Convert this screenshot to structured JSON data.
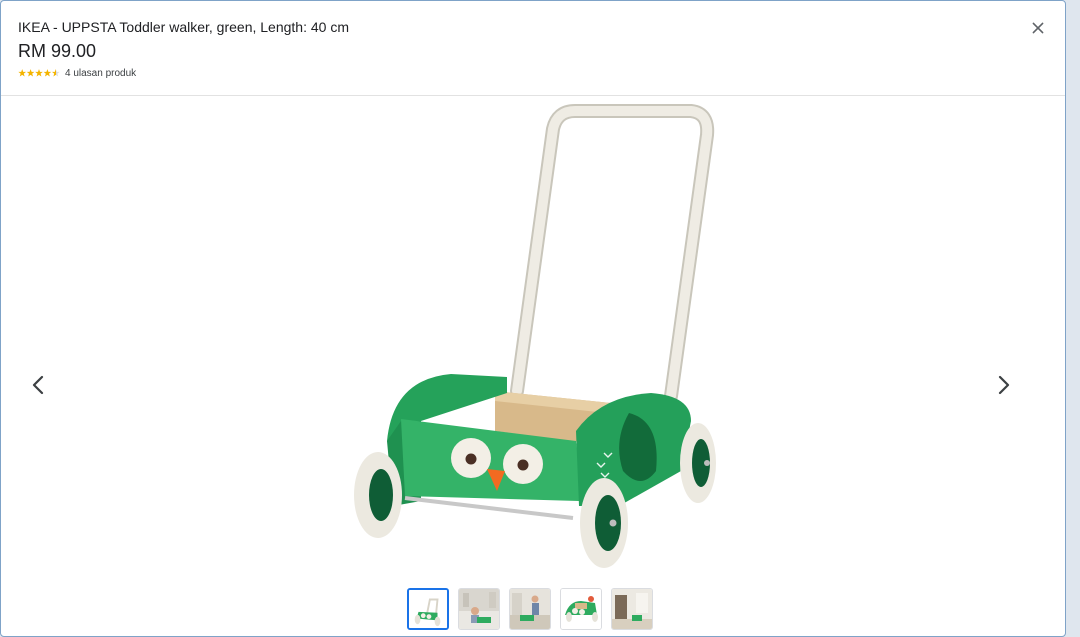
{
  "product": {
    "title": "IKEA - UPPSTA Toddler walker, green, Length: 40 cm",
    "price": "RM 99.00",
    "rating_value": 4.5,
    "rating_max": 5,
    "reviews_text": "4 ulasan produk"
  },
  "icons": {
    "close": "close-icon",
    "prev": "chevron-left-icon",
    "next": "chevron-right-icon",
    "stars": "star-rating-icon"
  },
  "colors": {
    "star": "#f4b400",
    "walker_green": "#2eab5f",
    "active_thumb_border": "#1a73e8"
  },
  "thumbnails": [
    {
      "name": "walker product shot",
      "active": true
    },
    {
      "name": "toddler with walker in room",
      "active": false
    },
    {
      "name": "child walking with walker",
      "active": false
    },
    {
      "name": "walker top view with toys",
      "active": false
    },
    {
      "name": "walker in bedroom",
      "active": false
    }
  ]
}
